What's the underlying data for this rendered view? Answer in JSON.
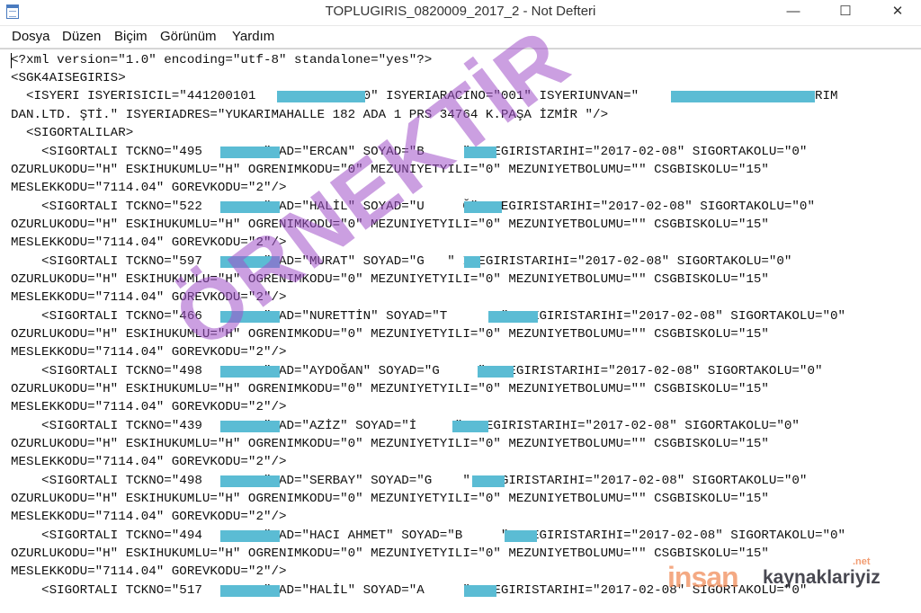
{
  "window": {
    "title": "TOPLUGIRIS_0820009_2017_2 - Not Defteri",
    "minimize_glyph": "—",
    "maximize_glyph": "☐",
    "close_glyph": "✕"
  },
  "menu": {
    "items": [
      "Dosya",
      "Düzen",
      "Biçim",
      "Görünüm",
      "Yardım"
    ]
  },
  "editor": {
    "lines": [
      "<?xml version=\"1.0\" encoding=\"utf-8\" standalone=\"yes\"?>",
      "<SGK4AISEGIRIS>",
      "  <ISYERI ISYERISICIL=\"441200101             10\" ISYERIARACINO=\"001\" ISYERIUNVAN=\"                   YATIRIM",
      "DAN.LTD. ŞTİ.\" ISYERIADRES=\"YUKARIMAHALLE 182 ADA 1 PRS 34764 K.PAŞA İZMİR \"/>",
      "  <SIGORTALILAR>",
      "    <SIGORTALI TCKNO=\"495       8\" AD=\"ERCAN\" SOYAD=\"B     \" ISEGIRISTARIHI=\"2017-02-08\" SIGORTAKOLU=\"0\"",
      "OZURLUKODU=\"H\" ESKIHUKUMLU=\"H\" OGRENIMKODU=\"0\" MEZUNIYETYILI=\"0\" MEZUNIYETBOLUMU=\"\" CSGBISKOLU=\"15\"",
      "MESLEKKODU=\"7114.04\" GOREVKODU=\"2\"/>",
      "    <SIGORTALI TCKNO=\"522       0\" AD=\"HALİL\" SOYAD=\"U     Ğ\" ISEGIRISTARIHI=\"2017-02-08\" SIGORTAKOLU=\"0\"",
      "OZURLUKODU=\"H\" ESKIHUKUMLU=\"H\" OGRENIMKODU=\"0\" MEZUNIYETYILI=\"0\" MEZUNIYETBOLUMU=\"\" CSGBISKOLU=\"15\"",
      "MESLEKKODU=\"7114.04\" GOREVKODU=\"2\"/>",
      "    <SIGORTALI TCKNO=\"597       2\" AD=\"MURAT\" SOYAD=\"G   \" ISEGIRISTARIHI=\"2017-02-08\" SIGORTAKOLU=\"0\"",
      "OZURLUKODU=\"H\" ESKIHUKUMLU=\"H\" OGRENIMKODU=\"0\" MEZUNIYETYILI=\"0\" MEZUNIYETBOLUMU=\"\" CSGBISKOLU=\"15\"",
      "MESLEKKODU=\"7114.04\" GOREVKODU=\"2\"/>",
      "    <SIGORTALI TCKNO=\"466       8\" AD=\"NURETTİN\" SOYAD=\"T       \" ISEGIRISTARIHI=\"2017-02-08\" SIGORTAKOLU=\"0\"",
      "OZURLUKODU=\"H\" ESKIHUKUMLU=\"H\" OGRENIMKODU=\"0\" MEZUNIYETYILI=\"0\" MEZUNIYETBOLUMU=\"\" CSGBISKOLU=\"15\"",
      "MESLEKKODU=\"7114.04\" GOREVKODU=\"2\"/>",
      "    <SIGORTALI TCKNO=\"498       6\" AD=\"AYDOĞAN\" SOYAD=\"G     \" ISEGIRISTARIHI=\"2017-02-08\" SIGORTAKOLU=\"0\"",
      "OZURLUKODU=\"H\" ESKIHUKUMLU=\"H\" OGRENIMKODU=\"0\" MEZUNIYETYILI=\"0\" MEZUNIYETBOLUMU=\"\" CSGBISKOLU=\"15\"",
      "MESLEKKODU=\"7114.04\" GOREVKODU=\"2\"/>",
      "    <SIGORTALI TCKNO=\"439       2\" AD=\"AZİZ\" SOYAD=\"İ     \" ISEGIRISTARIHI=\"2017-02-08\" SIGORTAKOLU=\"0\"",
      "OZURLUKODU=\"H\" ESKIHUKUMLU=\"H\" OGRENIMKODU=\"0\" MEZUNIYETYILI=\"0\" MEZUNIYETBOLUMU=\"\" CSGBISKOLU=\"15\"",
      "MESLEKKODU=\"7114.04\" GOREVKODU=\"2\"/>",
      "    <SIGORTALI TCKNO=\"498       2\" AD=\"SERBAY\" SOYAD=\"G    \" ISEGIRISTARIHI=\"2017-02-08\" SIGORTAKOLU=\"0\"",
      "OZURLUKODU=\"H\" ESKIHUKUMLU=\"H\" OGRENIMKODU=\"0\" MEZUNIYETYILI=\"0\" MEZUNIYETBOLUMU=\"\" CSGBISKOLU=\"15\"",
      "MESLEKKODU=\"7114.04\" GOREVKODU=\"2\"/>",
      "    <SIGORTALI TCKNO=\"494       8\" AD=\"HACI AHMET\" SOYAD=\"B     \" ISEGIRISTARIHI=\"2017-02-08\" SIGORTAKOLU=\"0\"",
      "OZURLUKODU=\"H\" ESKIHUKUMLU=\"H\" OGRENIMKODU=\"0\" MEZUNIYETYILI=\"0\" MEZUNIYETBOLUMU=\"\" CSGBISKOLU=\"15\"",
      "MESLEKKODU=\"7114.04\" GOREVKODU=\"2\"/>",
      "    <SIGORTALI TCKNO=\"517       8\" AD=\"HALİL\" SOYAD=\"A     \" ISEGIRISTARIHI=\"2017-02-08\" SIGORTAKOLU=\"0\""
    ]
  },
  "overlay": {
    "watermark": "ÖRNEKTİR",
    "brand_part1": "insan",
    "brand_part2": "kaynaklariyiz",
    "brand_part3": ".net"
  },
  "colors": {
    "redaction": "#5bbcd4",
    "watermark": "#a050c8",
    "brand_accent": "#f08c5a"
  }
}
